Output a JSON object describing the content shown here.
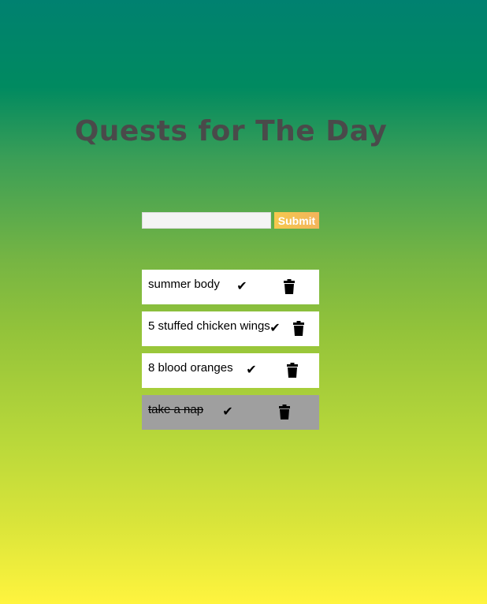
{
  "header": {
    "title": "Quests for The Day"
  },
  "form": {
    "input_value": "",
    "input_placeholder": "",
    "submit_label": "Submit"
  },
  "todos": [
    {
      "text": "summer body",
      "completed": false,
      "check_icon": "check-icon",
      "delete_icon": "trash-icon",
      "check_glyph": "✔"
    },
    {
      "text": "5 stuffed chicken wings",
      "completed": false,
      "check_icon": "check-icon",
      "delete_icon": "trash-icon",
      "check_glyph": "✔"
    },
    {
      "text": "8 blood oranges",
      "completed": false,
      "check_icon": "check-icon",
      "delete_icon": "trash-icon",
      "check_glyph": "✔"
    },
    {
      "text": "take a nap",
      "completed": true,
      "check_icon": "check-icon",
      "delete_icon": "trash-icon",
      "check_glyph": "✔"
    }
  ],
  "colors": {
    "title": "#4a4a4a",
    "submit_button": "#f2b45b",
    "item_background": "#ffffff",
    "completed_item_background": "#9f9f9f",
    "gradient_top": "#008170",
    "gradient_bottom": "#fff43e"
  }
}
